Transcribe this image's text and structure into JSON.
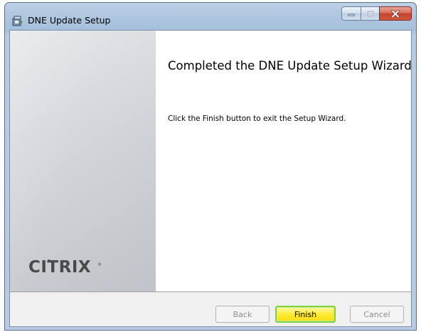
{
  "window": {
    "title": "DNE Update Setup"
  },
  "wizard": {
    "heading": "Completed the DNE Update Setup Wizard",
    "message": "Click the Finish button to exit the Setup Wizard.",
    "logo_text": "CITRIX"
  },
  "buttons": {
    "back": "Back",
    "finish": "Finish",
    "cancel": "Cancel"
  },
  "colors": {
    "finish_highlight": "#f7dd16",
    "close_button": "#c3432e"
  },
  "icons": {
    "app": "installer-icon",
    "minimize": "minimize-icon",
    "maximize": "maximize-icon",
    "close": "close-icon"
  }
}
